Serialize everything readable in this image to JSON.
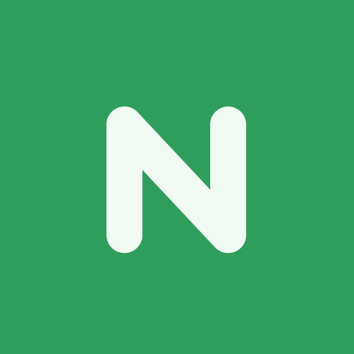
{
  "icon": {
    "name": "n-letter-logo-icon",
    "letter": "N",
    "colors": {
      "background": "#2f9e5c",
      "glyph": "#f1f9f3"
    }
  }
}
